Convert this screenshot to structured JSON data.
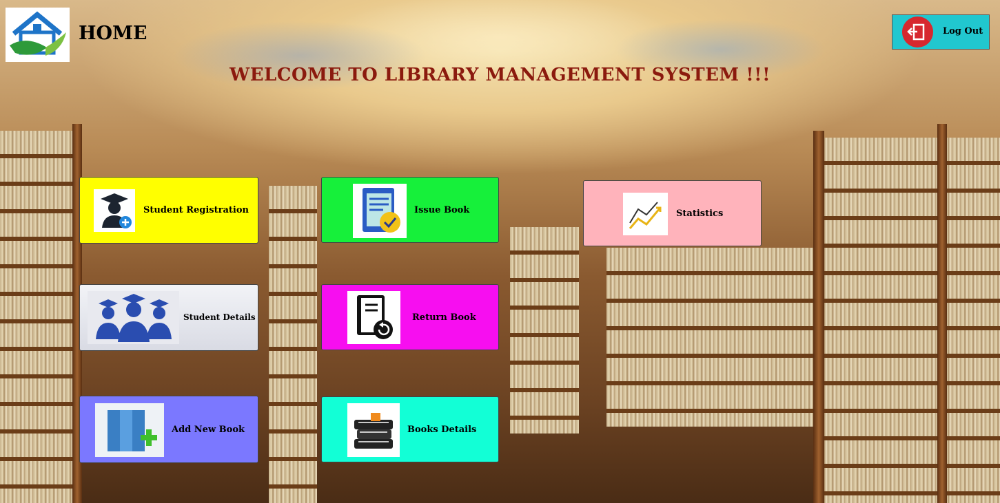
{
  "header": {
    "title": "HOME",
    "welcome": "WELCOME TO LIBRARY MANAGEMENT SYSTEM !!!",
    "logout_label": "Log Out"
  },
  "tiles": {
    "student_registration": {
      "label": "Student Registration",
      "color": "#ffff00"
    },
    "issue_book": {
      "label": "Issue Book",
      "color": "#16f03a"
    },
    "statistics": {
      "label": "Statistics",
      "color": "#ffb3bb"
    },
    "student_details": {
      "label": "Student Details",
      "color": "#e4e6ee"
    },
    "return_book": {
      "label": "Return Book",
      "color": "#f70ef0"
    },
    "add_new_book": {
      "label": "Add New Book",
      "color": "#7b78ff"
    },
    "books_details": {
      "label": "Books Details",
      "color": "#12ffd6"
    }
  },
  "icons": {
    "logo": "home-logo-icon",
    "logout": "logout-icon",
    "student_registration": "graduate-add-icon",
    "issue_book": "issue-document-icon",
    "statistics": "chart-icon",
    "student_details": "students-group-icon",
    "return_book": "return-book-icon",
    "add_new_book": "add-book-icon",
    "books_details": "book-stack-icon"
  }
}
